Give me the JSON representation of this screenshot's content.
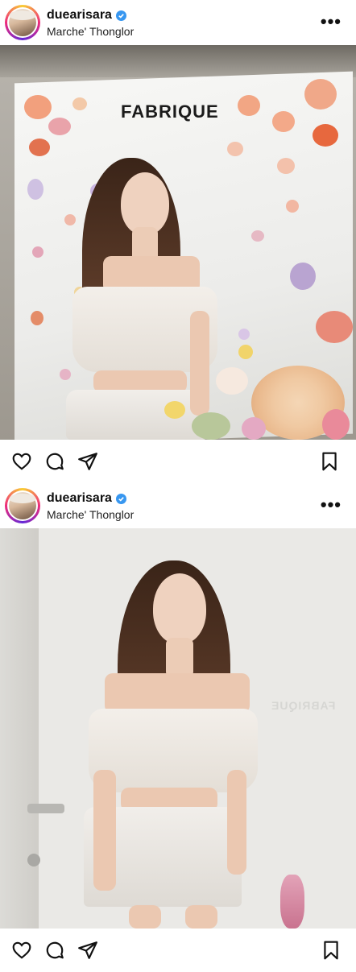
{
  "posts": [
    {
      "username": "duearisara",
      "location": "Marche' Thonglor",
      "photo_text": "FABRIQUE"
    },
    {
      "username": "duearisara",
      "location": "Marche' Thonglor",
      "photo_text": "FABRIQUE"
    }
  ],
  "icons": {
    "more": "more-options-icon",
    "like": "heart-icon",
    "comment": "comment-icon",
    "share": "send-icon",
    "save": "bookmark-icon",
    "verified": "verified-badge-icon"
  },
  "colors": {
    "verified": "#3897f0",
    "background": "#ffffff"
  }
}
